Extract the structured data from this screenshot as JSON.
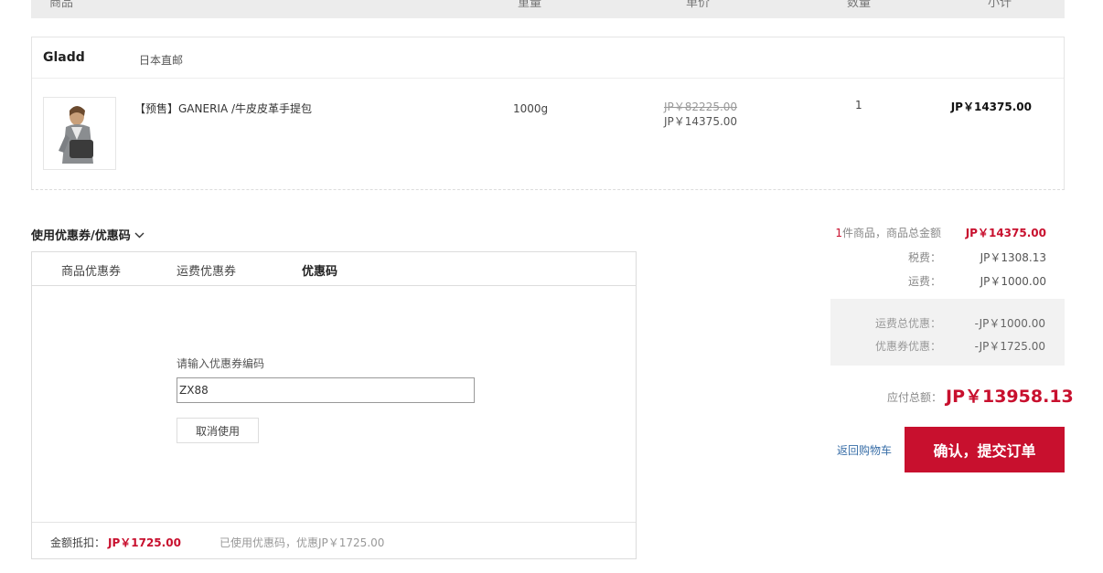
{
  "table_header": {
    "product": "商品",
    "weight": "重量",
    "unit_price": "单价",
    "quantity": "数量",
    "subtotal": "小计"
  },
  "shop": {
    "name": "Gladd",
    "tag": "日本直邮"
  },
  "item": {
    "name": "【预售】GANERIA /牛皮皮革手提包",
    "weight": "1000g",
    "original_price": "JP￥82225.00",
    "price": "JP￥14375.00",
    "quantity": "1",
    "subtotal": "JP￥14375.00"
  },
  "coupon": {
    "title": "使用优惠券/优惠码",
    "tabs": [
      "商品优惠券",
      "运费优惠券",
      "优惠码"
    ],
    "active_tab": "优惠码",
    "code_label": "请输入优惠券编码",
    "code_value": "ZX88",
    "cancel_label": "取消使用",
    "footer_label": "金额抵扣：",
    "footer_amount": "JP￥1725.00",
    "footer_note": "已使用优惠码，优惠JP￥1725.00"
  },
  "summary": {
    "item_count": "1",
    "goods_total_label": "件商品，商品总金额",
    "goods_total": "JP￥14375.00",
    "tax_label": "税费：",
    "tax": "JP￥1308.13",
    "shipping_label": "运费：",
    "shipping": "JP￥1000.00",
    "shipping_discount_label": "运费总优惠：",
    "shipping_discount": "-JP￥1000.00",
    "coupon_discount_label": "优惠券优惠：",
    "coupon_discount": "-JP￥1725.00",
    "payable_label": "应付总额：",
    "payable": "JP￥13958.13"
  },
  "actions": {
    "back_to_cart": "返回购物车",
    "submit": "确认，提交订单"
  },
  "colors": {
    "accent": "#c8102e",
    "link": "#3a6fa8"
  }
}
